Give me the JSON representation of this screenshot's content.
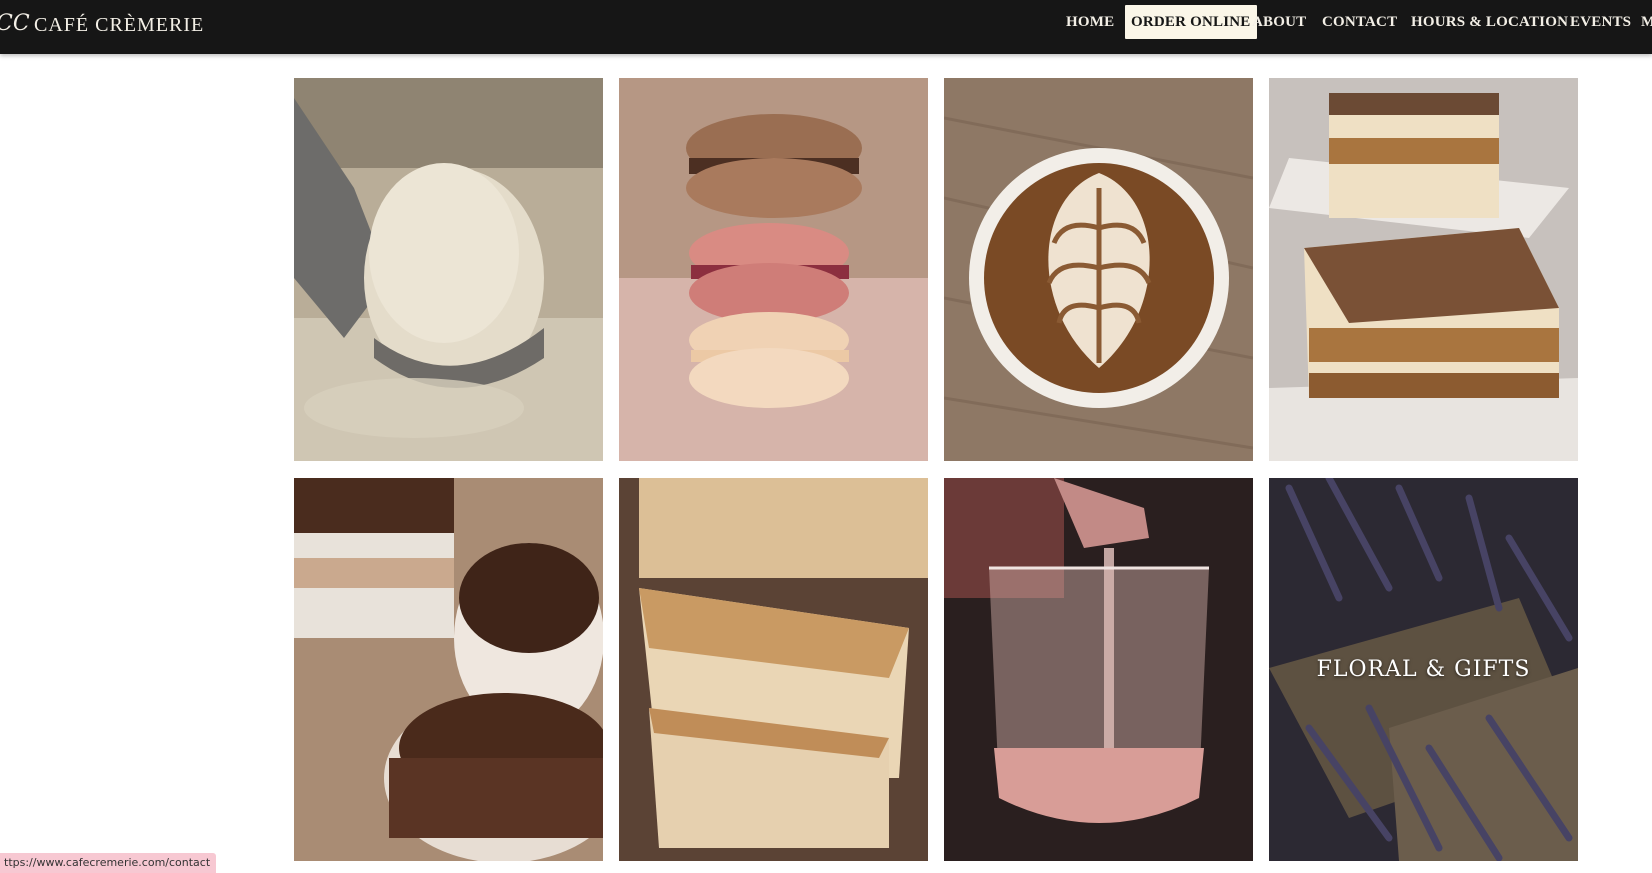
{
  "header": {
    "logo_mark": "CC",
    "brand": "CAFÉ CRÈMERIE"
  },
  "nav": {
    "items": [
      {
        "label": "HOME"
      },
      {
        "label": "ORDER ONLINE"
      },
      {
        "label": "ABOUT"
      },
      {
        "label": "CONTACT"
      },
      {
        "label": "HOURS & LOCATION"
      },
      {
        "label": "EVENTS"
      },
      {
        "label": "M"
      }
    ]
  },
  "gallery": {
    "tiles": [
      {
        "name": "ice-cream-scoop-image"
      },
      {
        "name": "macarons-image"
      },
      {
        "name": "latte-art-image"
      },
      {
        "name": "tiramisu-image"
      },
      {
        "name": "chocolate-mousse-image"
      },
      {
        "name": "focaccia-image"
      },
      {
        "name": "rose-wine-image"
      },
      {
        "name": "lavender-image",
        "caption": "FLORAL & GIFTS"
      }
    ]
  },
  "status_bar": {
    "url": "ttps://www.cafecremerie.com/contact"
  },
  "colors": {
    "navbar_bg": "#161616",
    "nav_text": "#f3efe6",
    "active_bg": "#fbf6e8",
    "status_bg": "#f7c8d2"
  },
  "icons": [
    "logo-monogram-icon"
  ]
}
